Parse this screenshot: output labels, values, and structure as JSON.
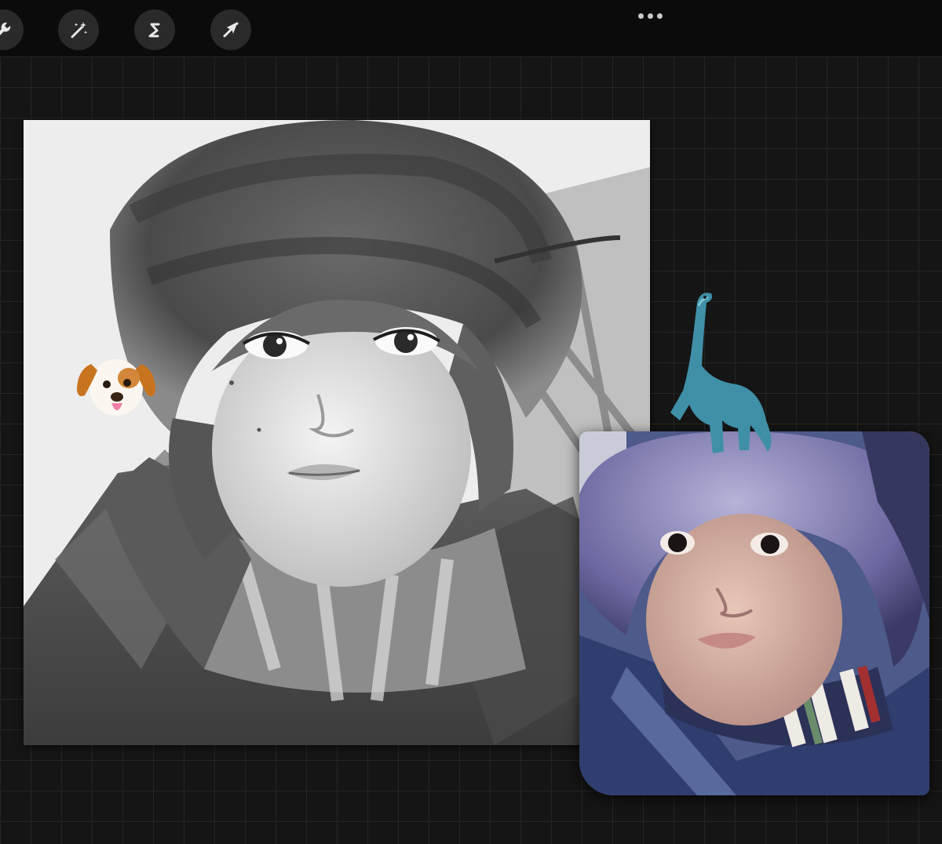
{
  "app": "drawing-canvas",
  "toolbar": {
    "tools": [
      {
        "name": "actions",
        "icon": "wrench-icon"
      },
      {
        "name": "adjustments",
        "icon": "magic-wand-icon"
      },
      {
        "name": "selection",
        "icon": "selection-s-icon"
      },
      {
        "name": "transform",
        "icon": "arrow-cursor-icon"
      }
    ],
    "more_icon": "ellipsis-icon"
  },
  "canvas": {
    "artwork": "grayscale-portrait-painting",
    "reference_image": "reference-photo-child-in-fur-hat",
    "stickers": [
      "dog-face-emoji",
      "dinosaur-figurine"
    ]
  },
  "colors": {
    "toolbar_bg": "#0b0b0b",
    "canvas_bg": "#151515",
    "grid_line": "#262626",
    "tool_button_bg": "#2a2a2a"
  }
}
